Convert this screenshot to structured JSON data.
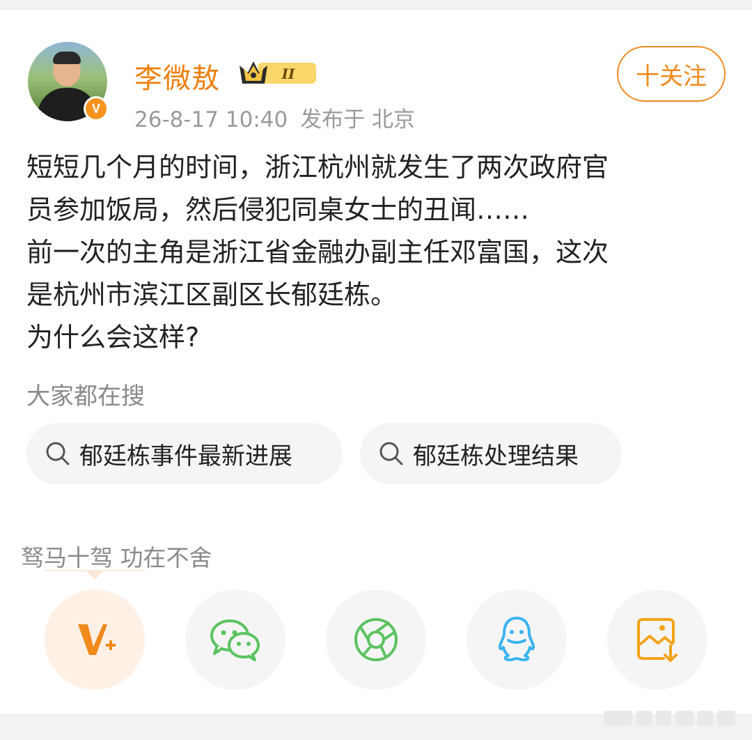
{
  "post": {
    "username": "李微敖",
    "level_badge": "II",
    "timestamp": "26-8-17 10:40",
    "location": "发布于 北京",
    "follow_label": "十关注",
    "lines": [
      "短短几个月的时间，浙江杭州就发生了两次政府官",
      "员参加饭局，然后侵犯同桌女士的丑闻……",
      "前一次的主角是浙江省金融办副主任邓富国，这次",
      "是杭州市滨江区副区长郁廷栋。",
      "为什么会这样?"
    ]
  },
  "search": {
    "title": "大家都在搜",
    "chips": [
      "郁廷栋事件最新进展",
      "郁廷栋处理结果"
    ]
  },
  "signature": "驽马十驾 功在不舍",
  "share_icons": [
    "weibo-vplus-icon",
    "wechat-icon",
    "moments-icon",
    "qq-icon",
    "save-image-icon"
  ],
  "colors": {
    "accent": "#f08a1c",
    "username": "#ef7f0a",
    "wechat": "#5bc360",
    "qq": "#3ab3f0"
  }
}
